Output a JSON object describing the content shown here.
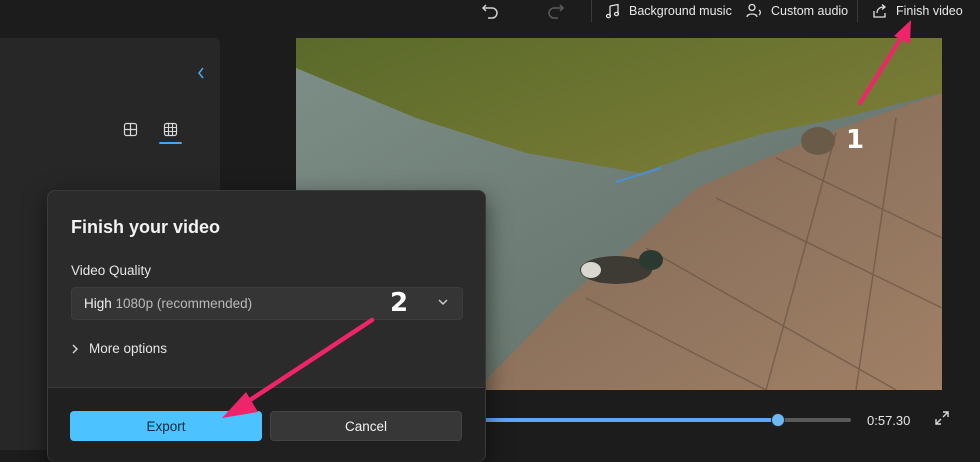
{
  "toolbar": {
    "background_music_label": "Background music",
    "custom_audio_label": "Custom audio",
    "finish_video_label": "Finish video"
  },
  "player": {
    "current_time": "0:57.30",
    "progress": 0.8
  },
  "dialog": {
    "title": "Finish your video",
    "quality_label": "Video Quality",
    "quality_value": "High",
    "quality_detail": "1080p (recommended)",
    "more_options_label": "More options",
    "export_label": "Export",
    "cancel_label": "Cancel"
  },
  "annotations": {
    "step1": "1",
    "step2": "2",
    "arrow_color": "#f0246b"
  },
  "colors": {
    "accent": "#4cc2ff",
    "timeline": "#60a5fa"
  }
}
